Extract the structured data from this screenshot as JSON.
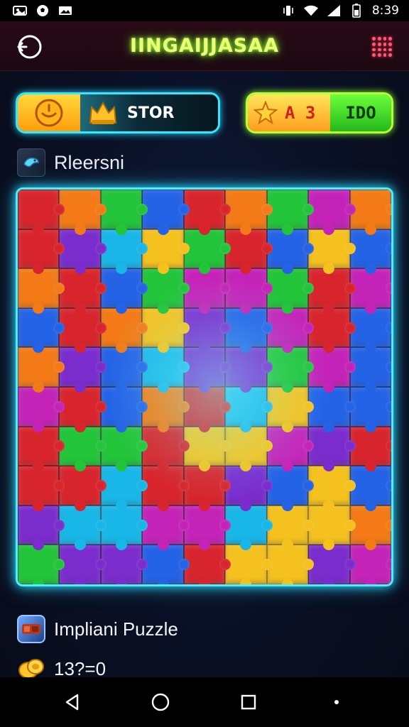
{
  "status_bar": {
    "time": "8:39",
    "left_icons": [
      "photo-icon",
      "soccer-icon",
      "gallery-icon"
    ],
    "right_icons": [
      "vibrate-icon",
      "wifi-icon",
      "signal-icon",
      "battery-icon"
    ]
  },
  "header": {
    "title": "IINGAIJJASAA",
    "back_icon": "back-icon",
    "menu_icon": "grid-menu-icon"
  },
  "stats": {
    "timer_icon": "clock-icon",
    "crown_icon": "crown-icon",
    "store_label": "STOR",
    "star_icon": "star-icon",
    "score_value": "A 3",
    "level_label": "IDO"
  },
  "section": {
    "icon": "puzzle-bird-icon",
    "label": "Rleersni"
  },
  "board": {
    "columns": 9,
    "rows": 10,
    "colors": {
      "green": "#22c43a",
      "blue": "#2462e6",
      "purple": "#7a2ccd",
      "red": "#d8242c",
      "orange": "#f37a16",
      "yellow": "#f5c11e",
      "cyan": "#19b6e8",
      "magenta": "#c423b8"
    }
  },
  "info": {
    "puzzle_icon": "puzzle-piece-icon",
    "puzzle_label": "Impliani Puzzle",
    "coin_icon": "coin-icon",
    "coin_value": "13?=0"
  },
  "navbar": {
    "back": "nav-back-icon",
    "home": "nav-home-icon",
    "recents": "nav-recents-icon"
  }
}
